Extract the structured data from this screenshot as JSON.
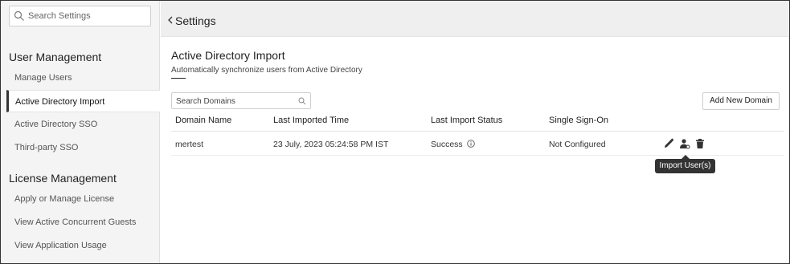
{
  "sidebar": {
    "search_placeholder": "Search Settings",
    "sections": [
      {
        "title": "User Management",
        "items": [
          "Manage Users",
          "Active Directory Import",
          "Active Directory SSO",
          "Third-party SSO"
        ]
      },
      {
        "title": "License Management",
        "items": [
          "Apply or Manage License",
          "View Active Concurrent Guests",
          "View Application Usage"
        ]
      }
    ]
  },
  "topbar": {
    "title": "Settings"
  },
  "main": {
    "title": "Active Directory Import",
    "subtitle": "Automatically synchronize users from Active Directory",
    "search_placeholder": "Search Domains",
    "add_button": "Add New Domain",
    "table": {
      "headers": [
        "Domain Name",
        "Last Imported Time",
        "Last Import Status",
        "Single Sign-On"
      ],
      "rows": [
        {
          "domain": "mertest",
          "imported": "23 July, 2023 05:24:58 PM IST",
          "status": "Success",
          "sso": "Not Configured"
        }
      ]
    },
    "tooltip": "Import User(s)"
  },
  "colors": {
    "active_border": "#333333",
    "tooltip_bg": "#333333",
    "topbar_bg": "#efefef",
    "sidebar_bg": "#f4f4f4"
  }
}
